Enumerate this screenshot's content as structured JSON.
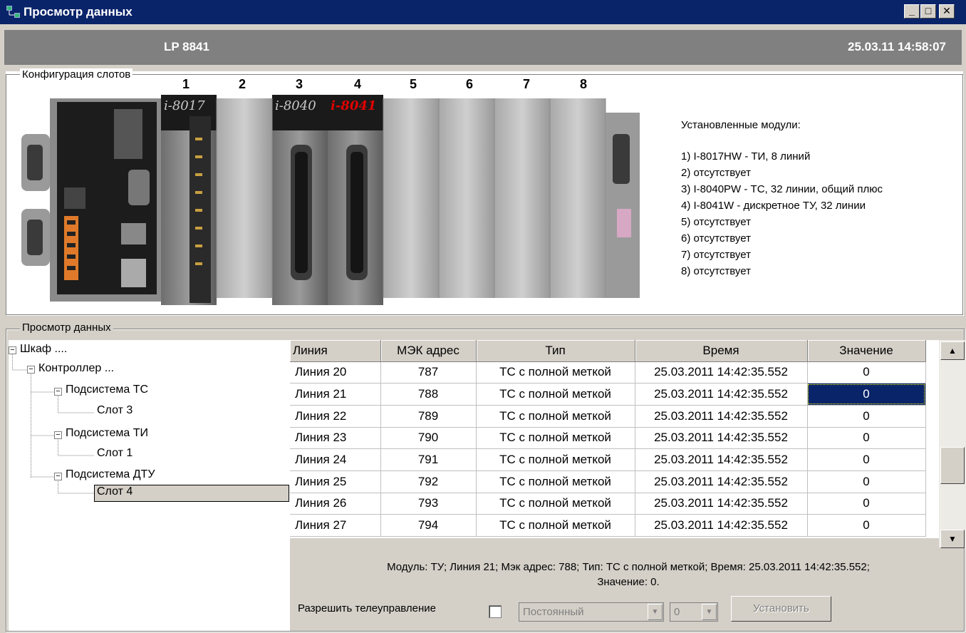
{
  "window": {
    "title": "Просмотр данных",
    "minimize": "_",
    "maximize": "□",
    "close": "✕"
  },
  "header": {
    "device": "LP 8841",
    "datetime": "25.03.11 14:58:07"
  },
  "slots_group": {
    "label": "Конфигурация слотов",
    "slot_numbers": [
      "1",
      "2",
      "3",
      "4",
      "5",
      "6",
      "7",
      "8"
    ],
    "module_badges": {
      "slot1": "i-8017",
      "slot3": "i-8040",
      "slot4": "i-8041"
    },
    "installed_heading": "Установленные модули:",
    "installed_modules": [
      "1) I-8017HW - ТИ, 8 линий",
      "2) отсутствует",
      "3) I-8040PW - ТС, 32 линии, общий плюс",
      "4) I-8041W - дискретное ТУ, 32 линии",
      "5) отсутствует",
      "6) отсутствует",
      "7) отсутствует",
      "8) отсутствует"
    ]
  },
  "data_group": {
    "label": "Просмотр данных"
  },
  "tree": {
    "nodes": [
      {
        "label": "Шкаф ...."
      },
      {
        "label": "Контроллер ..."
      },
      {
        "label": "Подсистема ТС"
      },
      {
        "label": "Слот 3"
      },
      {
        "label": "Подсистема ТИ"
      },
      {
        "label": "Слот 1"
      },
      {
        "label": "Подсистема ДТУ"
      },
      {
        "label": "Слот 4"
      }
    ]
  },
  "grid": {
    "columns": [
      "Линия",
      "МЭК адрес",
      "Тип",
      "Время",
      "Значение"
    ],
    "rows": [
      [
        "Линия 20",
        "787",
        "ТС с полной меткой",
        "25.03.2011 14:42:35.552",
        "0"
      ],
      [
        "Линия 21",
        "788",
        "ТС с полной меткой",
        "25.03.2011 14:42:35.552",
        "0"
      ],
      [
        "Линия 22",
        "789",
        "ТС с полной меткой",
        "25.03.2011 14:42:35.552",
        "0"
      ],
      [
        "Линия 23",
        "790",
        "ТС с полной меткой",
        "25.03.2011 14:42:35.552",
        "0"
      ],
      [
        "Линия 24",
        "791",
        "ТС с полной меткой",
        "25.03.2011 14:42:35.552",
        "0"
      ],
      [
        "Линия 25",
        "792",
        "ТС с полной меткой",
        "25.03.2011 14:42:35.552",
        "0"
      ],
      [
        "Линия 26",
        "793",
        "ТС с полной меткой",
        "25.03.2011 14:42:35.552",
        "0"
      ],
      [
        "Линия 27",
        "794",
        "ТС с полной меткой",
        "25.03.2011 14:42:35.552",
        "0"
      ]
    ],
    "selected_row": 1,
    "scroll_up": "▲",
    "scroll_down": "▼"
  },
  "status": {
    "line1": "Модуль: ТУ; Линия 21; Мэк адрес: 788; Тип: ТС с полной меткой; Время: 25.03.2011 14:42:35.552;",
    "line2": "Значение: 0."
  },
  "controls": {
    "allow_label": "Разрешить телеуправление",
    "allow_checked": false,
    "mode_value": "Постоянный",
    "number_value": "0",
    "set_button": "Установить",
    "combo_arrow": "▼"
  },
  "colors": {
    "titlebar": "#0a246a",
    "header": "#808080",
    "selection": "#0a246a",
    "badge_red": "#e00000"
  }
}
